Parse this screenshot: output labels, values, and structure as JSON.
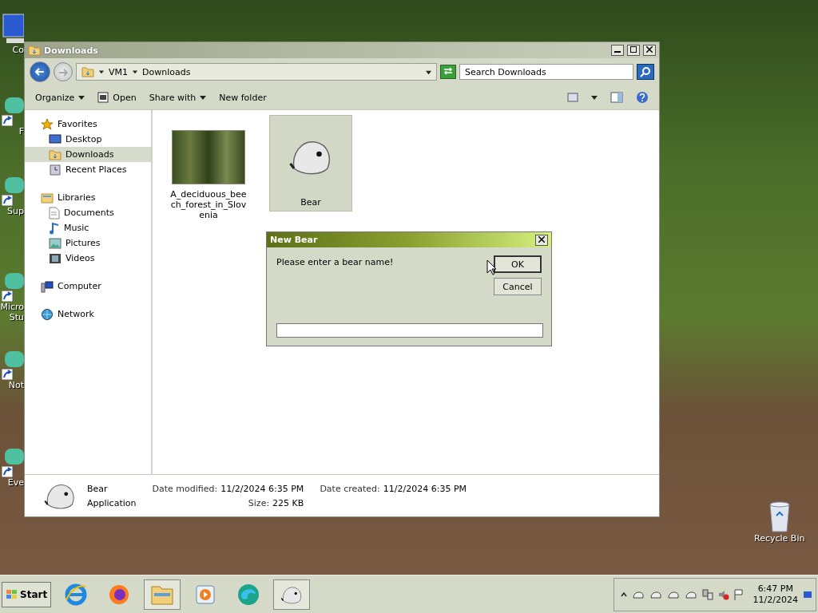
{
  "desktop_icons": [
    {
      "label": "Co",
      "kind": "computer"
    },
    {
      "label": "F",
      "kind": "shortcut"
    },
    {
      "label": "Sup",
      "kind": "shortcut"
    },
    {
      "label": "Micro Stu",
      "kind": "shortcut"
    },
    {
      "label": "Not",
      "kind": "shortcut"
    },
    {
      "label": "Eve",
      "kind": "shortcut"
    }
  ],
  "recycle_bin": {
    "label": "Recycle Bin"
  },
  "explorer": {
    "title": "Downloads",
    "address": {
      "breadcrumb": [
        "VM1",
        "Downloads"
      ],
      "search_placeholder": "Search Downloads"
    },
    "toolbar": [
      {
        "label": "Organize",
        "kind": "menu"
      },
      {
        "label": "Open",
        "kind": "open"
      },
      {
        "label": "Share with",
        "kind": "menu"
      },
      {
        "label": "New folder",
        "kind": "plain"
      }
    ],
    "sidebar": [
      {
        "label": "Favorites",
        "kind": "star",
        "selected": false,
        "children": [
          {
            "label": "Desktop",
            "kind": "desktop",
            "selected": false
          },
          {
            "label": "Downloads",
            "kind": "folder",
            "selected": true
          },
          {
            "label": "Recent Places",
            "kind": "recent",
            "selected": false
          }
        ]
      },
      {
        "label": "Libraries",
        "kind": "library",
        "selected": false,
        "children": [
          {
            "label": "Documents",
            "kind": "doc",
            "selected": false
          },
          {
            "label": "Music",
            "kind": "music",
            "selected": false
          },
          {
            "label": "Pictures",
            "kind": "pictures",
            "selected": false
          },
          {
            "label": "Videos",
            "kind": "videos",
            "selected": false
          }
        ]
      },
      {
        "label": "Computer",
        "kind": "computer",
        "selected": false
      },
      {
        "label": "Network",
        "kind": "network",
        "selected": false
      }
    ],
    "files": [
      {
        "name": "A_deciduous_beech_forest_in_Slovenia",
        "kind": "image",
        "selected": false
      },
      {
        "name": "Bear",
        "kind": "app",
        "selected": true
      }
    ],
    "details": {
      "name": "Bear",
      "type": "Application",
      "fields": [
        {
          "label": "Date modified:",
          "value": "11/2/2024 6:35 PM"
        },
        {
          "label": "Date created:",
          "value": "11/2/2024 6:35 PM"
        },
        {
          "label": "Size:",
          "value": "225 KB"
        }
      ]
    }
  },
  "dialog": {
    "title": "New Bear",
    "message": "Please enter a bear name!",
    "buttons": [
      {
        "label": "OK",
        "default": true
      },
      {
        "label": "Cancel",
        "default": false
      }
    ]
  },
  "taskbar": {
    "start": "Start",
    "apps": [
      {
        "kind": "ie",
        "active": false
      },
      {
        "kind": "firefox",
        "active": false
      },
      {
        "kind": "explorer",
        "active": true
      },
      {
        "kind": "media",
        "active": false
      },
      {
        "kind": "edge",
        "active": false
      },
      {
        "kind": "bear",
        "active": true
      }
    ],
    "tray": {
      "time": "6:47 PM",
      "date": "11/2/2024"
    }
  }
}
